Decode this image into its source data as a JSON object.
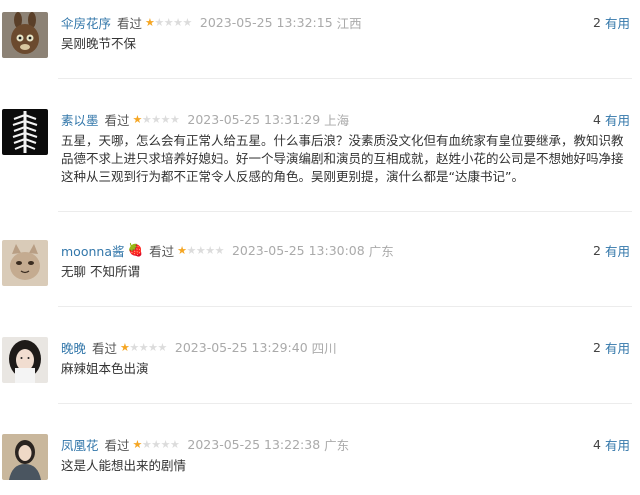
{
  "comments": [
    {
      "user": "伞房花序",
      "emoji": "",
      "status": "看过",
      "rating": 1,
      "time": "2023-05-25 13:32:15",
      "location": "江西",
      "useful_count": "2",
      "useful_label": "有用",
      "content": "吴刚晚节不保",
      "avatar_icon": "brown-bunny-plush-avatar-icon"
    },
    {
      "user": "素以墨",
      "emoji": "",
      "status": "看过",
      "rating": 1,
      "time": "2023-05-25 13:31:29",
      "location": "上海",
      "useful_count": "4",
      "useful_label": "有用",
      "content": "五星，天哪，怎么会有正常人给五星。什么事后浪？没素质没文化但有血统家有皇位要继承，教知识教品德不求上进只求培养好媳妇。好一个导演编剧和演员的互相成就，赵姓小花的公司是不想她好吗净接这种从三观到行为都不正常令人反感的角色。吴刚更别提，演什么都是“达康书记”。",
      "avatar_icon": "black-white-feather-pattern-avatar-icon"
    },
    {
      "user": "moonna酱",
      "emoji": "🍓",
      "status": "看过",
      "rating": 1,
      "time": "2023-05-25 13:30:08",
      "location": "广东",
      "useful_count": "2",
      "useful_label": "有用",
      "content": "无聊 不知所谓",
      "avatar_icon": "cartoon-cat-avatar-icon"
    },
    {
      "user": "晚晚",
      "emoji": "",
      "status": "看过",
      "rating": 1,
      "time": "2023-05-25 13:29:40",
      "location": "四川",
      "useful_count": "2",
      "useful_label": "有用",
      "content": "麻辣姐本色出演",
      "avatar_icon": "girl-portrait-avatar-icon"
    },
    {
      "user": "凤凰花",
      "emoji": "",
      "status": "看过",
      "rating": 1,
      "time": "2023-05-25 13:22:38",
      "location": "广东",
      "useful_count": "4",
      "useful_label": "有用",
      "content": "这是人能想出来的剧情",
      "avatar_icon": "person-portrait-avatar-icon"
    }
  ],
  "colors": {
    "username": "#3377aa",
    "useful_link": "#3377aa",
    "star_on": "#f5a623",
    "star_off": "#dcdcdc",
    "meta_gray": "#aaaaaa",
    "separator": "#ececec"
  }
}
